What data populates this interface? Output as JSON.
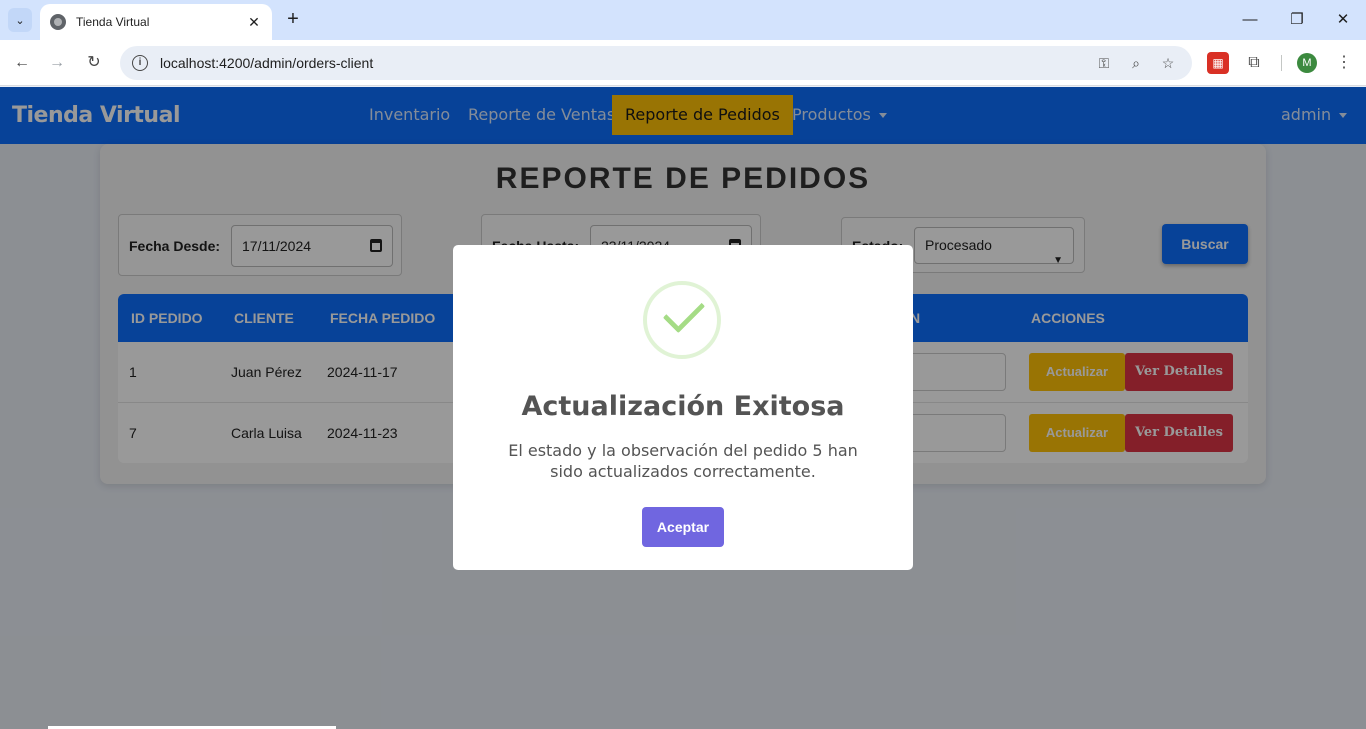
{
  "browser": {
    "tab_title": "Tienda Virtual",
    "url": "localhost:4200/admin/orders-client",
    "avatar_letter": "M"
  },
  "navbar": {
    "brand": "Tienda Virtual",
    "links": [
      "Inventario",
      "Reporte de Ventas",
      "Reporte de Pedidos",
      "Productos"
    ],
    "active_link": "Reporte de Pedidos",
    "user": "admin",
    "accent": "#0d6efd",
    "active_color": "#ffc107"
  },
  "page": {
    "title": "REPORTE DE PEDIDOS",
    "filters": {
      "from_label": "Fecha Desde:",
      "from_value": "17/11/2024",
      "to_label": "Fecha Hasta:",
      "to_value": "23/11/2024",
      "status_label": "Estado:",
      "status_value": "Procesado"
    },
    "search_button": "Buscar"
  },
  "table": {
    "headers": [
      "ID PEDIDO",
      "CLIENTE",
      "FECHA PEDIDO",
      "N",
      "ACCIONES"
    ],
    "rows": [
      {
        "id": "1",
        "client": "Juan Pérez",
        "date": "2024-11-17"
      },
      {
        "id": "7",
        "client": "Carla Luisa",
        "date": "2024-11-23"
      }
    ],
    "action_update": "Actualizar",
    "action_details": "Ver Detalles"
  },
  "modal": {
    "icon": "success-check-icon",
    "title": "Actualización Exitosa",
    "message": "El estado y la observación del pedido 5 han sido actualizados correctamente.",
    "confirm": "Aceptar",
    "confirm_color": "#7066e0"
  }
}
